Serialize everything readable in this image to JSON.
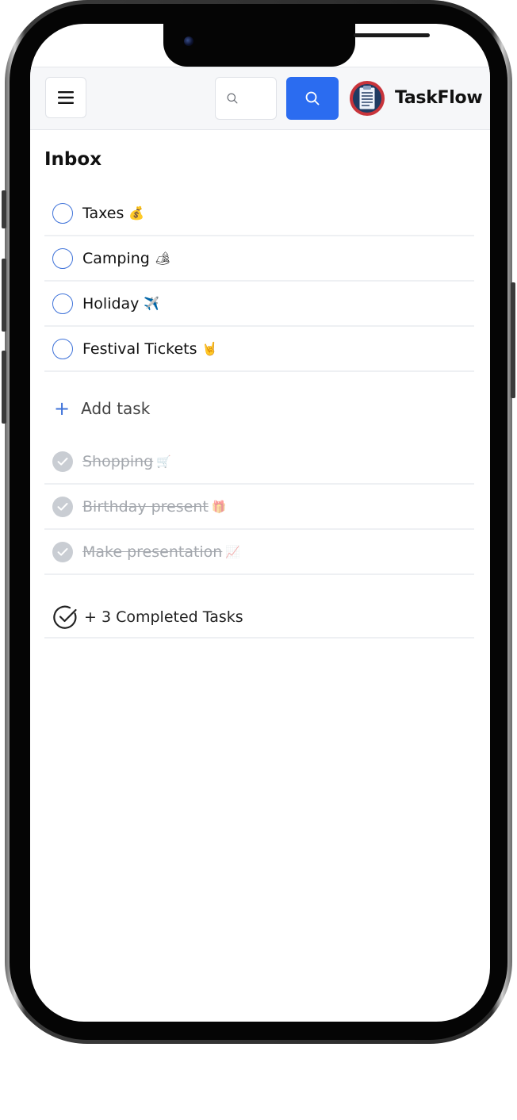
{
  "header": {
    "menu_icon": "hamburger-menu-icon",
    "search": {
      "value": "",
      "placeholder": ""
    },
    "search_icon": "search-icon",
    "logo_icon": "clipboard-list-icon",
    "brand": "TaskFlow",
    "accent": "#2b6cf0"
  },
  "inbox": {
    "title": "Inbox",
    "tasks": [
      {
        "label": "Taxes",
        "emoji": "💰"
      },
      {
        "label": "Camping",
        "emoji": "🏕"
      },
      {
        "label": "Holiday",
        "emoji": "✈️"
      },
      {
        "label": "Festival Tickets",
        "emoji": "🤘"
      }
    ],
    "add_task_label": "Add task",
    "completed": [
      {
        "label": "Shopping",
        "emoji": "🛒"
      },
      {
        "label": "Birthday present",
        "emoji": "🎁"
      },
      {
        "label": "Make presentation",
        "emoji": "📈"
      }
    ],
    "completed_summary": "+ 3 Completed Tasks"
  }
}
